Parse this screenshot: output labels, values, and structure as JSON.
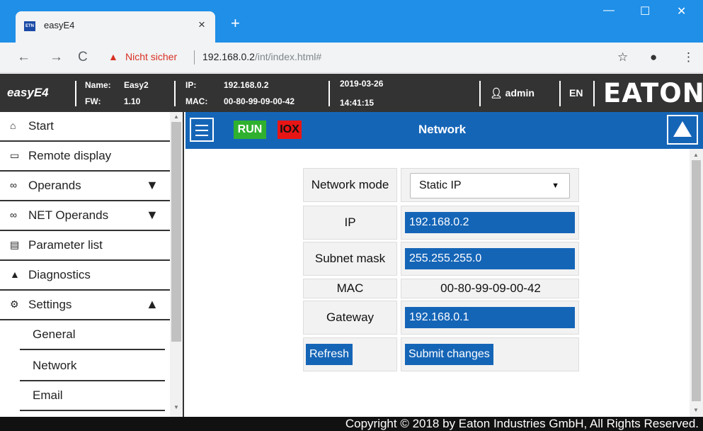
{
  "browser": {
    "tab_title": "easyE4",
    "favicon_text": "ETN",
    "tab_close": "×",
    "new_tab": "+",
    "window_controls": {
      "minimize": "—",
      "maximize": "☐",
      "close": "✕"
    },
    "security_label": "Nicht sicher",
    "url_host": "192.168.0.2",
    "url_path": "/int/index.html#",
    "icons": [
      "back-icon",
      "forward-icon",
      "reload-icon",
      "warning-icon",
      "star-icon",
      "account-icon",
      "menu-dots-icon"
    ]
  },
  "header": {
    "logo_text": "easyE4",
    "name_label": "Name:",
    "name_value": "Easy2",
    "fw_label": "FW:",
    "fw_value": "1.10",
    "ip_label": "IP:",
    "ip_value": "192.168.0.2",
    "mac_label": "MAC:",
    "mac_value": "00-80-99-09-00-42",
    "date": "2019-03-26",
    "time": "14:41:15",
    "user": "admin",
    "language": "EN",
    "brand": "EATON"
  },
  "sidebar": {
    "items": [
      {
        "label": "Start",
        "icon": "home-icon"
      },
      {
        "label": "Remote display",
        "icon": "monitor-icon"
      },
      {
        "label": "Operands",
        "icon": "glasses-icon",
        "arrow": "down"
      },
      {
        "label": "NET Operands",
        "icon": "glasses-icon",
        "arrow": "down"
      },
      {
        "label": "Parameter list",
        "icon": "list-icon"
      },
      {
        "label": "Diagnostics",
        "icon": "warning-icon"
      },
      {
        "label": "Settings",
        "icon": "gear-icon",
        "arrow": "up"
      }
    ],
    "sub_items": [
      {
        "label": "General"
      },
      {
        "label": "Network"
      },
      {
        "label": "Email"
      }
    ]
  },
  "toolbar": {
    "run": "RUN",
    "iox": "IOX",
    "title": "Network"
  },
  "network_form": {
    "mode_label": "Network mode",
    "mode_value": "Static IP",
    "ip_label": "IP",
    "ip_value": "192.168.0.2",
    "subnet_label": "Subnet mask",
    "subnet_value": "255.255.255.0",
    "mac_label": "MAC",
    "mac_value": "00-80-99-09-00-42",
    "gateway_label": "Gateway",
    "gateway_value": "192.168.0.1",
    "refresh_button": "Refresh",
    "submit_button": "Submit changes"
  },
  "footer": {
    "copyright": "Copyright © 2018 by Eaton Industries GmbH, All Rights Reserved."
  }
}
